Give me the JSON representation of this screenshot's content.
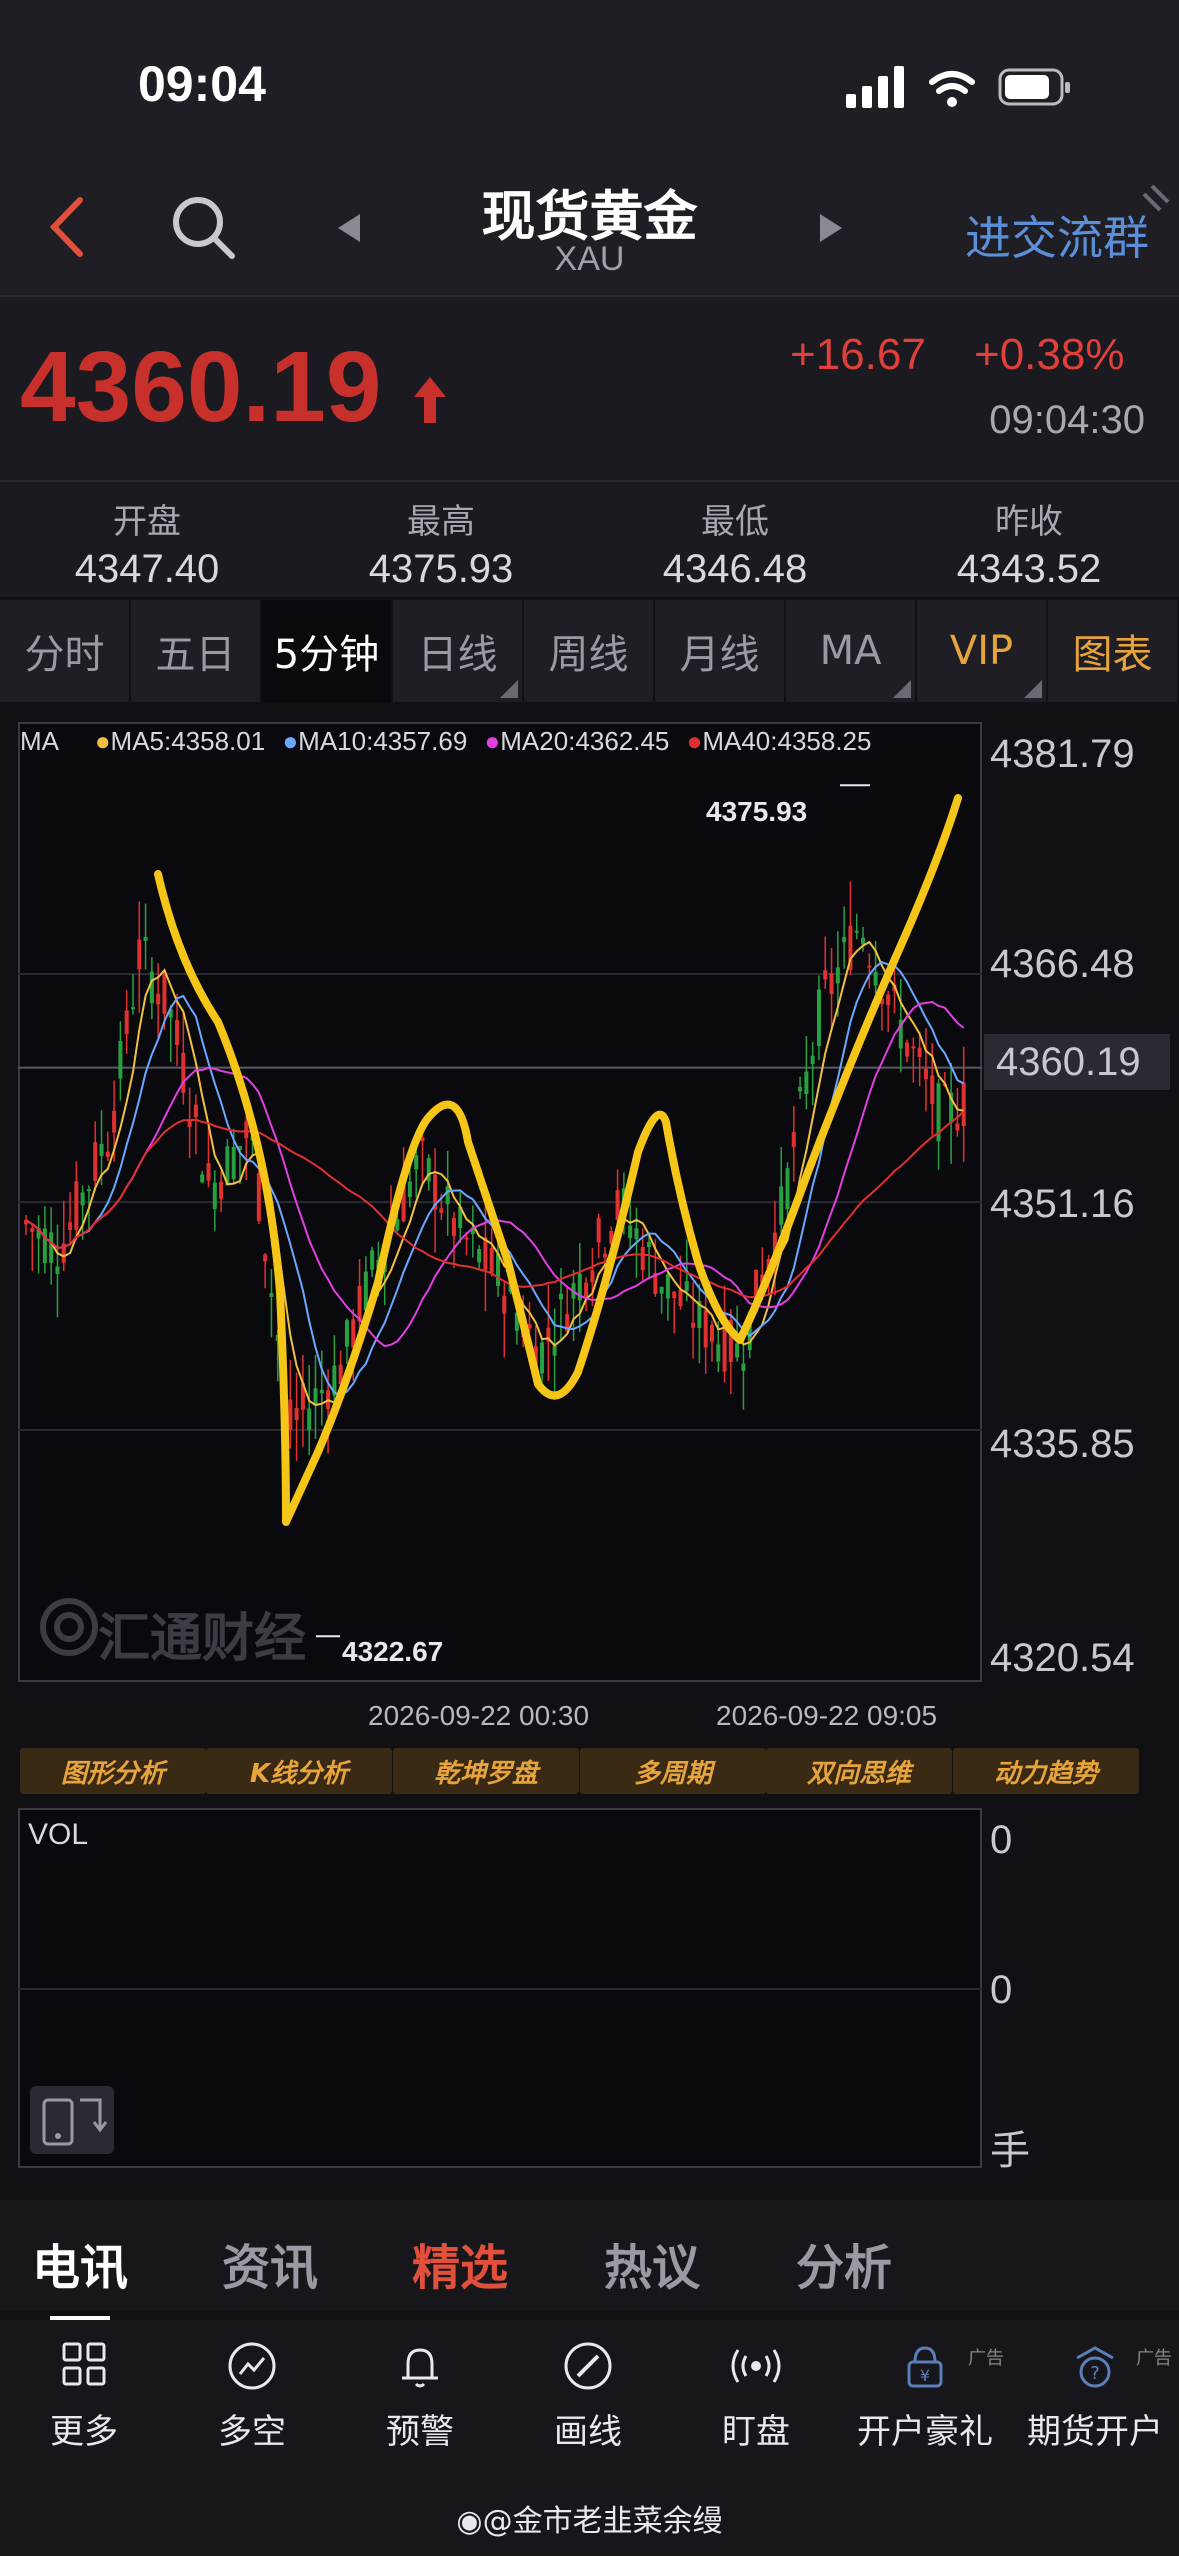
{
  "status": {
    "time": "09:04"
  },
  "header": {
    "title": "现货黄金",
    "subtitle": "XAU",
    "join_label": "进交流群"
  },
  "quote": {
    "price": "4360.19",
    "change": "+16.67",
    "change_pct": "+0.38%",
    "time": "09:04:30"
  },
  "stats": [
    {
      "label": "开盘",
      "value": "4347.40"
    },
    {
      "label": "最高",
      "value": "4375.93"
    },
    {
      "label": "最低",
      "value": "4346.48"
    },
    {
      "label": "昨收",
      "value": "4343.52"
    }
  ],
  "tabs": [
    "分时",
    "五日",
    "5分钟",
    "日线",
    "周线",
    "月线",
    "MA",
    "VIP",
    "图表"
  ],
  "ma_legend": {
    "label": "MA",
    "items": [
      {
        "text": "MA5:4358.01",
        "color": "#f0c040"
      },
      {
        "text": "MA10:4357.69",
        "color": "#6aa8ff"
      },
      {
        "text": "MA20:4362.45",
        "color": "#e040e0"
      },
      {
        "text": "MA40:4358.25",
        "color": "#e03030"
      }
    ]
  },
  "chart_data": {
    "type": "candlestick",
    "y_ticks": [
      "4381.79",
      "4366.48",
      "4360.19",
      "4351.16",
      "4335.85",
      "4320.54"
    ],
    "ylim": [
      4320.54,
      4381.79
    ],
    "x_ticks": [
      "2026-09-22 00:30",
      "2026-09-22 09:05"
    ],
    "high_marker": "4375.93",
    "low_marker": "4322.67",
    "watermark": "汇通财经",
    "annotation": "hand-drawn yellow trend line",
    "colors": {
      "up": "#e03030",
      "down": "#28a040",
      "annotation": "#f5c518"
    }
  },
  "tools": [
    "图形分析",
    "K线分析",
    "乾坤罗盘",
    "多周期",
    "双向思维",
    "动力趋势"
  ],
  "volume": {
    "label": "VOL",
    "ticks": [
      "0",
      "0",
      "手"
    ]
  },
  "news_tabs": [
    "电讯",
    "资讯",
    "精选",
    "热议",
    "分析"
  ],
  "bottom_items": [
    {
      "label": "更多",
      "icon": "grid-icon"
    },
    {
      "label": "多空",
      "icon": "trend-circle-icon"
    },
    {
      "label": "预警",
      "icon": "bell-icon"
    },
    {
      "label": "画线",
      "icon": "pen-circle-icon"
    },
    {
      "label": "盯盘",
      "icon": "broadcast-icon"
    },
    {
      "label": "开户豪礼",
      "icon": "gift-lock-icon",
      "ad": "广告"
    },
    {
      "label": "期货开户",
      "icon": "question-badge-icon",
      "ad": "广告"
    }
  ],
  "watermark": "@金市老韭菜余缦"
}
